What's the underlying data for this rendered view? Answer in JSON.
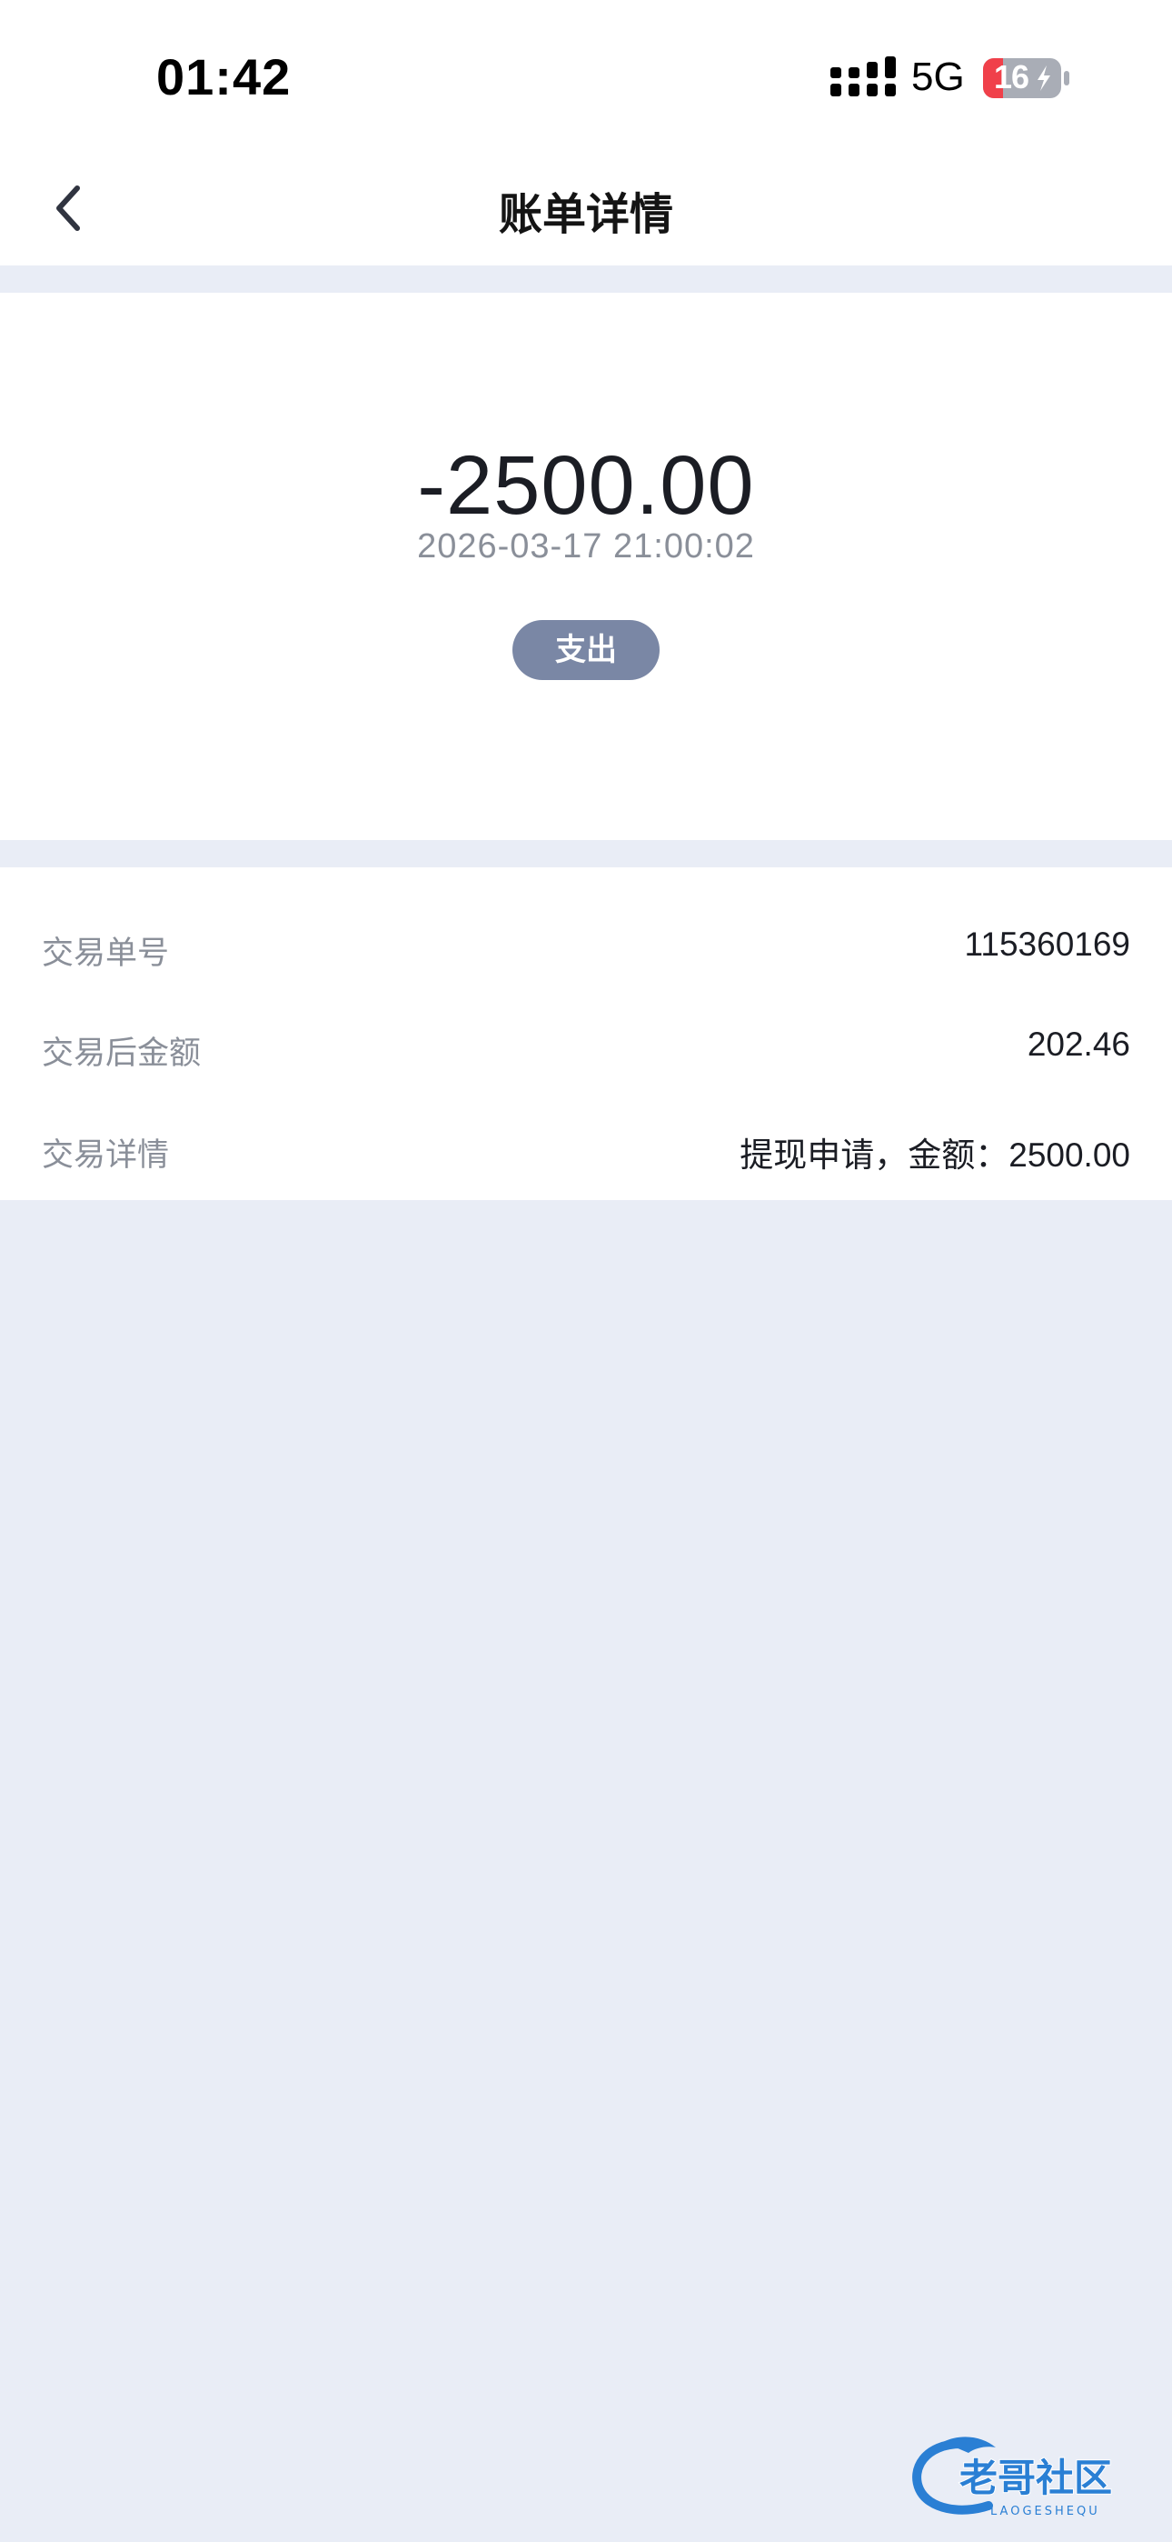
{
  "status_bar": {
    "time": "01:42",
    "network": "5G",
    "battery_level": "16"
  },
  "header": {
    "title": "账单详情",
    "back_icon": "chevron-left-icon"
  },
  "bill": {
    "amount": "-2500.00",
    "datetime": "2026-03-17 21:00:02",
    "type": "支出"
  },
  "details": [
    {
      "label": "交易单号",
      "value": "115360169"
    },
    {
      "label": "交易后金额",
      "value": "202.46"
    },
    {
      "label": "交易详情",
      "value": "提现申请，金额：2500.00"
    }
  ],
  "watermark": {
    "text": "老哥社区",
    "subtext": "LAOGESHEQU"
  },
  "colors": {
    "page_background": "#e9edf6",
    "badge_background": "#7a87a5",
    "label_gray": "#8a8f99",
    "battery_low": "#f0404a"
  }
}
